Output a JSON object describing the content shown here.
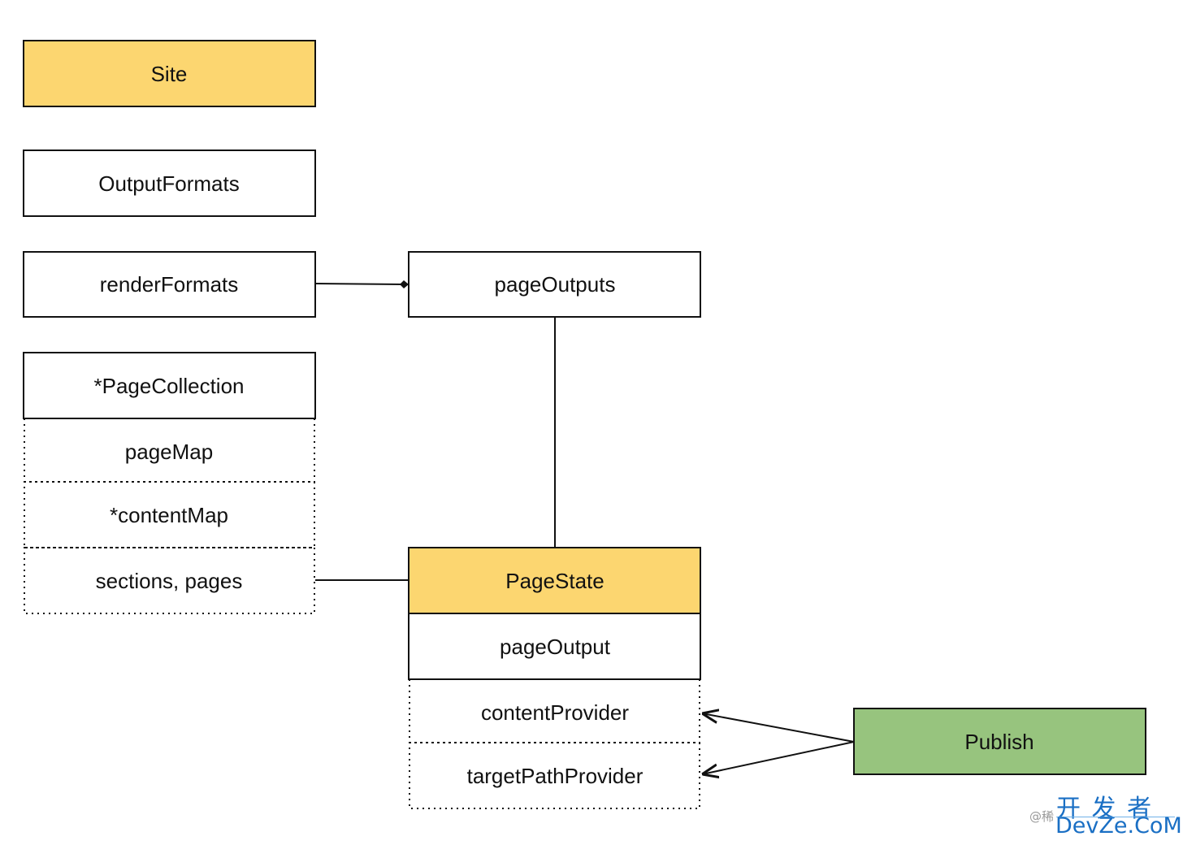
{
  "colors": {
    "highlight": "#fcd670",
    "publish": "#97c47e",
    "stroke": "#111111"
  },
  "boxes": {
    "site": "Site",
    "output_formats": "OutputFormats",
    "render_formats": "renderFormats",
    "page_outputs": "pageOutputs",
    "page_collection": "*PageCollection",
    "page_map": "pageMap",
    "content_map": "*contentMap",
    "sections_pages": "sections, pages",
    "page_state": "PageState",
    "page_output": "pageOutput",
    "content_provider": "contentProvider",
    "target_path_provider": "targetPathProvider",
    "publish": "Publish"
  },
  "watermark": {
    "prefix": "@稀",
    "cn": "开 发 者",
    "en": "DevZe.CoM"
  }
}
